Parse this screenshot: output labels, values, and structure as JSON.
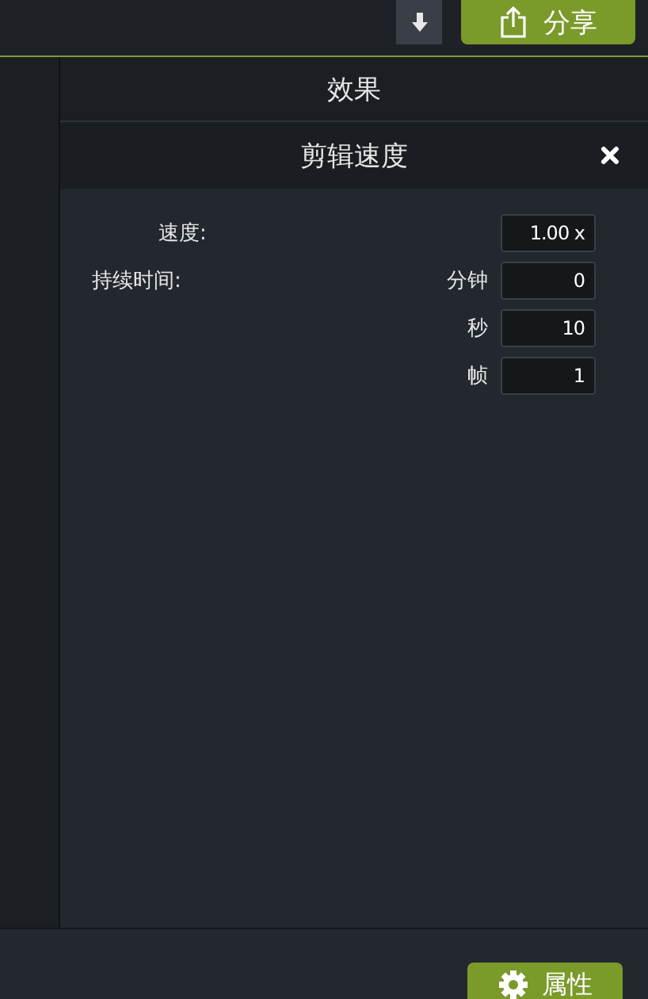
{
  "top_bar": {
    "share_button": "分享"
  },
  "panel": {
    "title": "效果",
    "effect_title": "剪辑速度",
    "speed": {
      "label": "速度:",
      "value": "1.00 x"
    },
    "duration": {
      "label": "持续时间:",
      "fields": [
        {
          "unit": "分钟",
          "value": "0"
        },
        {
          "unit": "秒",
          "value": "10"
        },
        {
          "unit": "帧",
          "value": "1"
        }
      ]
    }
  },
  "bottom_bar": {
    "properties_button": "属性"
  }
}
